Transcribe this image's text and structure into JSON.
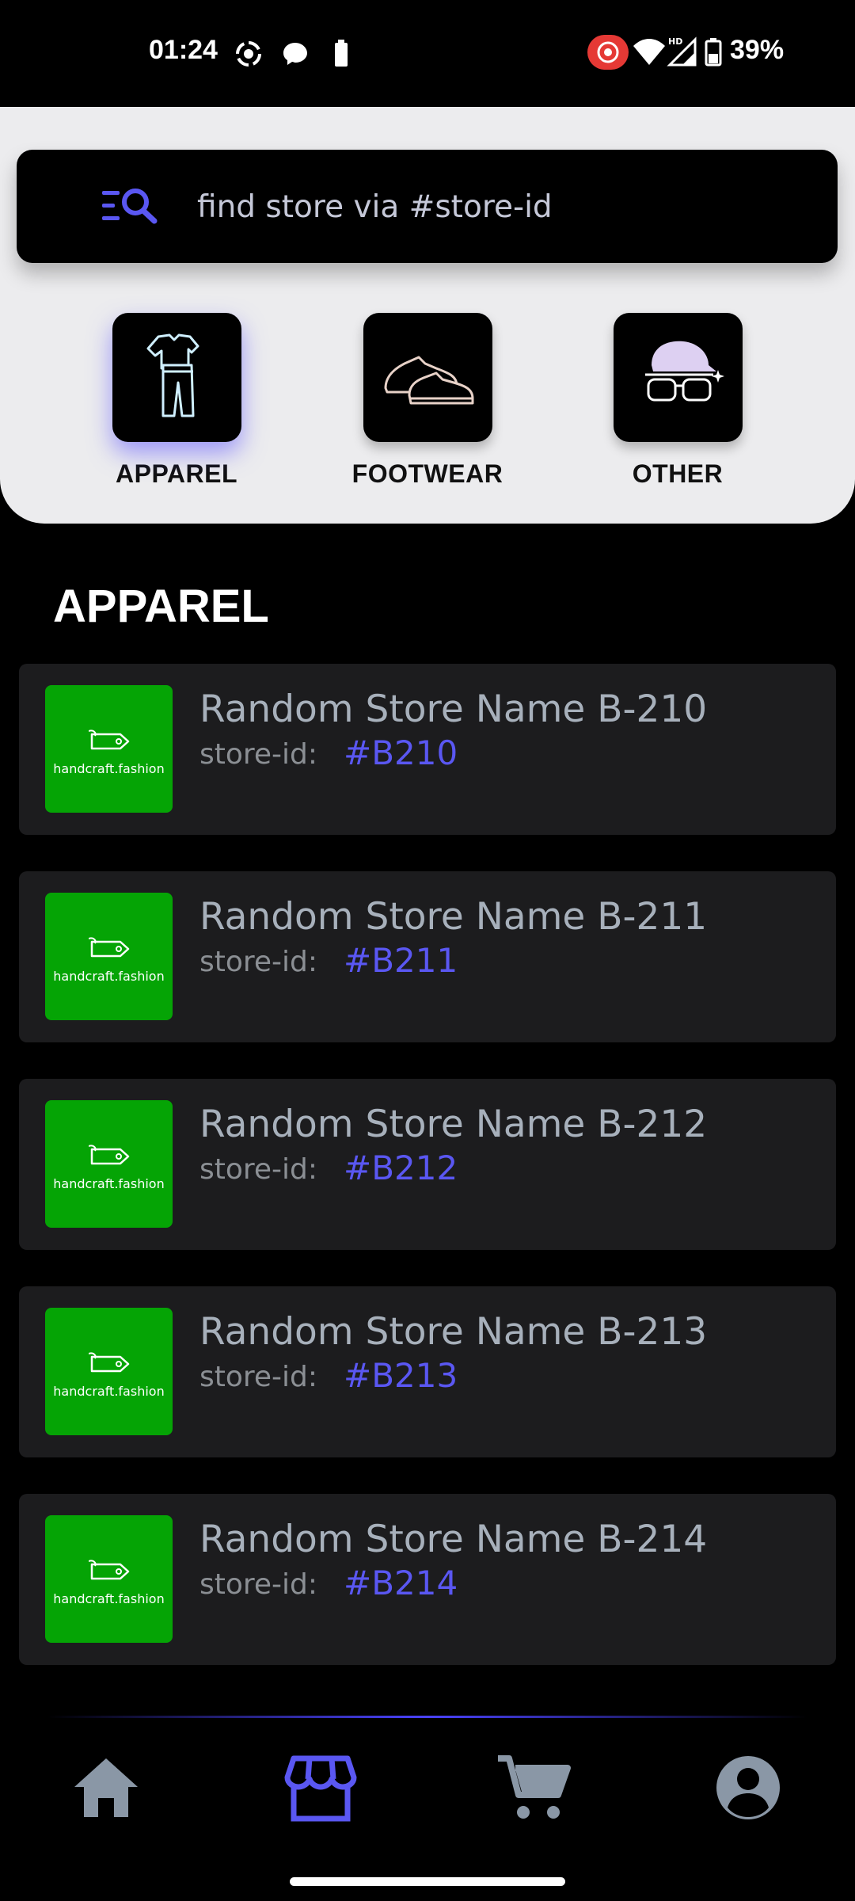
{
  "status_bar": {
    "time": "01:24",
    "battery_percent": "39%",
    "icons": [
      "screen-record-icon",
      "messenger-icon",
      "battery-small-icon",
      "cast-record-icon",
      "wifi-icon",
      "signal-hd-icon",
      "battery-icon"
    ]
  },
  "search": {
    "placeholder": "find store via #store-id",
    "icon": "search-filter-icon"
  },
  "categories": [
    {
      "label": "APPAREL",
      "icon": "apparel-icon",
      "active": true
    },
    {
      "label": "FOOTWEAR",
      "icon": "footwear-icon",
      "active": false
    },
    {
      "label": "OTHER",
      "icon": "cap-glasses-icon",
      "active": false
    }
  ],
  "section": {
    "title": "APPAREL"
  },
  "stores": [
    {
      "name": "Random Store Name B-210",
      "id_label": "store-id:",
      "id": "#B210",
      "logo_text": "handcraft.fashion"
    },
    {
      "name": "Random Store Name B-211",
      "id_label": "store-id:",
      "id": "#B211",
      "logo_text": "handcraft.fashion"
    },
    {
      "name": "Random Store Name B-212",
      "id_label": "store-id:",
      "id": "#B212",
      "logo_text": "handcraft.fashion"
    },
    {
      "name": "Random Store Name B-213",
      "id_label": "store-id:",
      "id": "#B213",
      "logo_text": "handcraft.fashion"
    },
    {
      "name": "Random Store Name B-214",
      "id_label": "store-id:",
      "id": "#B214",
      "logo_text": "handcraft.fashion"
    }
  ],
  "nav": [
    {
      "name": "home-icon",
      "active": false
    },
    {
      "name": "store-icon",
      "active": true
    },
    {
      "name": "cart-icon",
      "active": false
    },
    {
      "name": "account-icon",
      "active": false
    }
  ],
  "colors": {
    "accent": "#5a57f2",
    "panel_bg": "#ececee",
    "card_bg": "#1c1c1e",
    "logo_green": "#05a405",
    "nav_inactive": "#8a97a6"
  }
}
